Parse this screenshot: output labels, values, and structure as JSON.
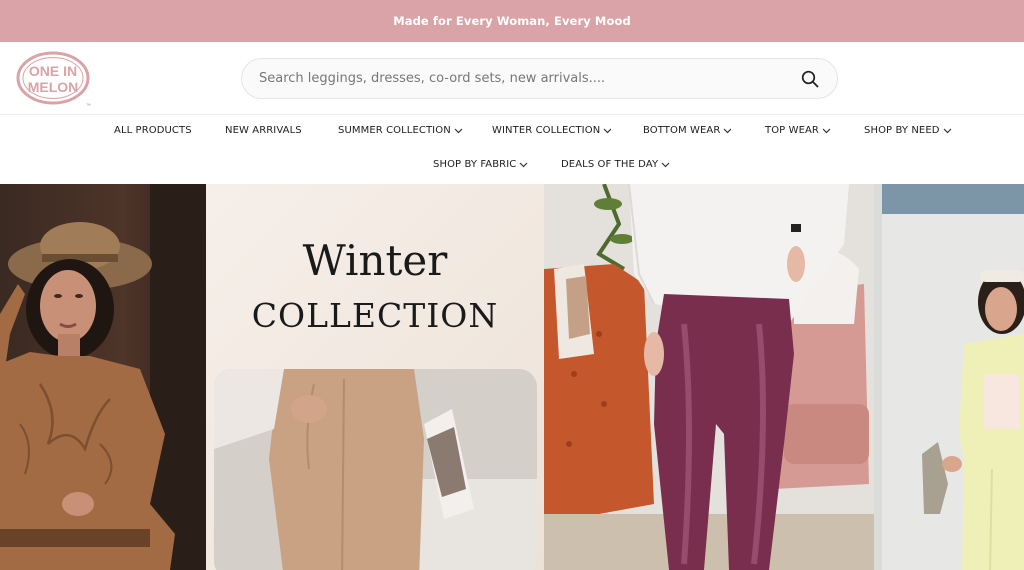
{
  "announcement": {
    "text": "Made for Every Woman, Every Mood"
  },
  "brand": {
    "name": "ONE IN MELON",
    "logo_line1": "ONE IN",
    "logo_line2": "MELON",
    "color": "#d9a3a7"
  },
  "search": {
    "placeholder": "Search leggings, dresses, co-ord sets, new arrivals....",
    "icon": "search-icon"
  },
  "nav": {
    "items": [
      {
        "label": "ALL PRODUCTS",
        "has_dropdown": false
      },
      {
        "label": "NEW ARRIVALS",
        "has_dropdown": false
      },
      {
        "label": "SUMMER COLLECTION",
        "has_dropdown": true
      },
      {
        "label": "WINTER COLLECTION",
        "has_dropdown": true
      },
      {
        "label": "BOTTOM WEAR",
        "has_dropdown": true
      },
      {
        "label": "TOP WEAR",
        "has_dropdown": true
      },
      {
        "label": "SHOP BY NEED",
        "has_dropdown": true
      },
      {
        "label": "SHOP BY FABRIC",
        "has_dropdown": true
      },
      {
        "label": "DEALS OF THE DAY",
        "has_dropdown": true
      }
    ]
  },
  "hero": {
    "title": "Winter",
    "subtitle": "COLLECTION"
  },
  "colors": {
    "accent": "#d9a3a7",
    "text": "#1d1d1d"
  }
}
